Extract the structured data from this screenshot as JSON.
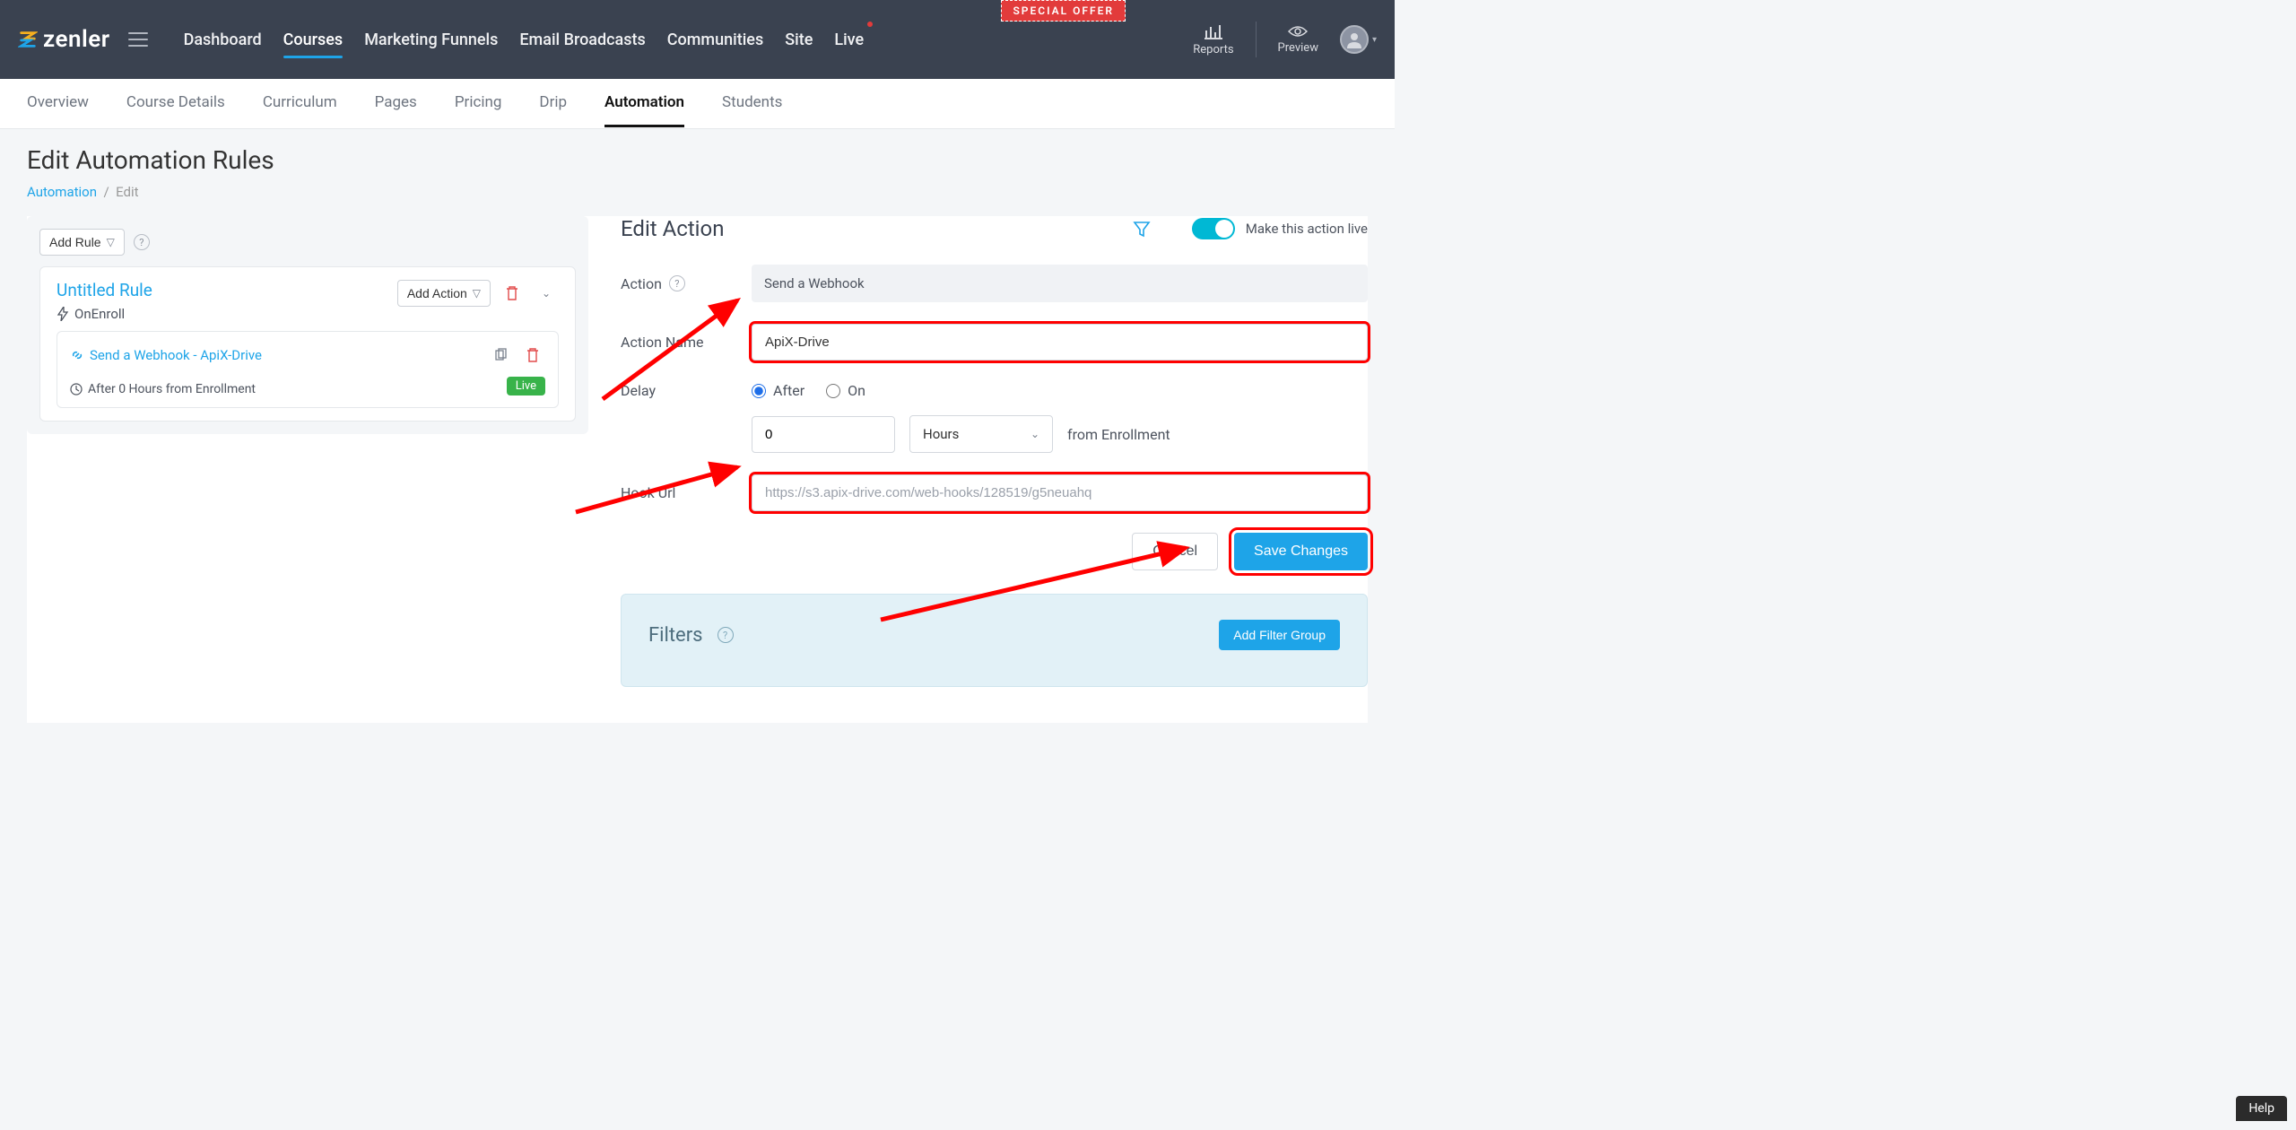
{
  "brand": "zenler",
  "special_offer": "SPECIAL OFFER",
  "main_nav": {
    "dashboard": "Dashboard",
    "courses": "Courses",
    "marketing": "Marketing Funnels",
    "email": "Email Broadcasts",
    "communities": "Communities",
    "site": "Site",
    "live": "Live"
  },
  "topbar_right": {
    "reports": "Reports",
    "preview": "Preview"
  },
  "sub_tabs": {
    "overview": "Overview",
    "details": "Course Details",
    "curriculum": "Curriculum",
    "pages": "Pages",
    "pricing": "Pricing",
    "drip": "Drip",
    "automation": "Automation",
    "students": "Students"
  },
  "page": {
    "title": "Edit Automation Rules",
    "crumb_root": "Automation",
    "crumb_sep": "/",
    "crumb_current": "Edit"
  },
  "rules": {
    "add_rule": "Add Rule",
    "rule_title": "Untitled Rule",
    "trigger": "OnEnroll",
    "add_action": "Add Action",
    "action_label": "Send a Webhook - ApiX-Drive",
    "action_timing": "After 0 Hours from Enrollment",
    "live_badge": "Live"
  },
  "edit": {
    "title": "Edit Action",
    "make_live": "Make this action live",
    "labels": {
      "action": "Action",
      "action_name": "Action Name",
      "delay": "Delay",
      "hook": "Hook Url"
    },
    "action_value": "Send a Webhook",
    "action_name_value": "ApiX-Drive",
    "delay_after": "After",
    "delay_on": "On",
    "delay_value": "0",
    "delay_unit": "Hours",
    "from_text": "from Enrollment",
    "hook_placeholder": "https://s3.apix-drive.com/web-hooks/128519/g5neuahq",
    "cancel": "Cancel",
    "save": "Save Changes"
  },
  "filters": {
    "title": "Filters",
    "add_group": "Add Filter Group"
  },
  "help": "Help"
}
